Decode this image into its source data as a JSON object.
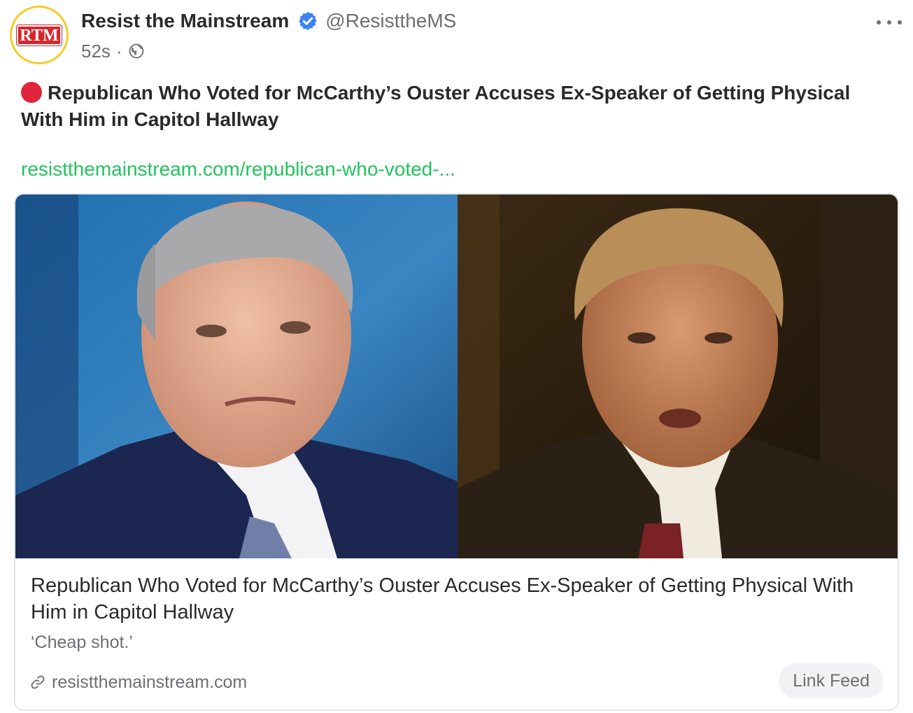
{
  "author": {
    "avatar_text": "RTM",
    "name": "Resist the Mainstream",
    "handle": "@ResisttheMS",
    "timestamp": "52s",
    "separator": "·",
    "verified_icon": "verified-badge-icon",
    "visibility_icon": "globe-icon"
  },
  "menu": {
    "icon": "more-horizontal-icon"
  },
  "post": {
    "emoji": "red-circle",
    "text": "Republican Who Voted for McCarthy’s Ouster Accuses Ex-Speaker of Getting Physical With Him in Capitol Hallway",
    "link": "resistthemainstream.com/republican-who-voted-..."
  },
  "card": {
    "title": "Republican Who Voted for McCarthy’s Ouster Accuses Ex-Speaker of Getting Physical With Him in Capitol Hallway",
    "subtitle": "‘Cheap shot.’",
    "domain": "resistthemainstream.com",
    "domain_icon": "link-icon",
    "button_label": "Link Feed"
  },
  "colors": {
    "link_green": "#22c35e",
    "verified_blue": "#3b82f6",
    "red_dot": "#e0263a",
    "avatar_ring": "#f3cc2b",
    "muted": "#6e6e73"
  }
}
